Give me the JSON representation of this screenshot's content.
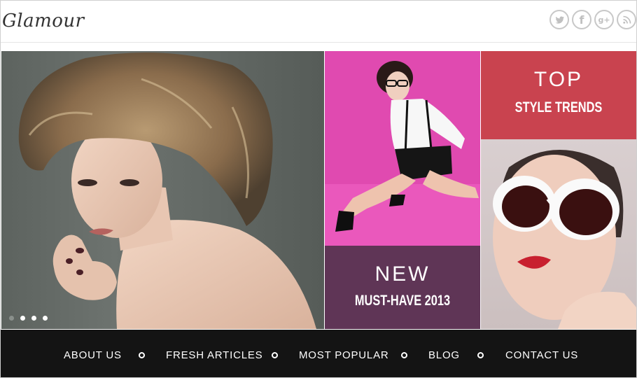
{
  "header": {
    "logo": "Glamour",
    "social": [
      {
        "name": "twitter-icon"
      },
      {
        "name": "facebook-icon",
        "glyph": "f"
      },
      {
        "name": "google-plus-icon",
        "glyph": "g+"
      },
      {
        "name": "rss-icon"
      }
    ]
  },
  "promos": {
    "new": {
      "title": "NEW",
      "subtitle": "MUST-HAVE 2013"
    },
    "top": {
      "title": "TOP",
      "subtitle": "STYLE TRENDS"
    }
  },
  "slider": {
    "dots": 4,
    "active_index": 1
  },
  "nav": {
    "items": [
      "ABOUT US",
      "FRESH ARTICLES",
      "MOST POPULAR",
      "BLOG",
      "CONTACT US"
    ]
  },
  "colors": {
    "pink": "#e04ab0",
    "plum": "#5f3556",
    "red": "#c9434f",
    "nav_bg": "#141414"
  }
}
